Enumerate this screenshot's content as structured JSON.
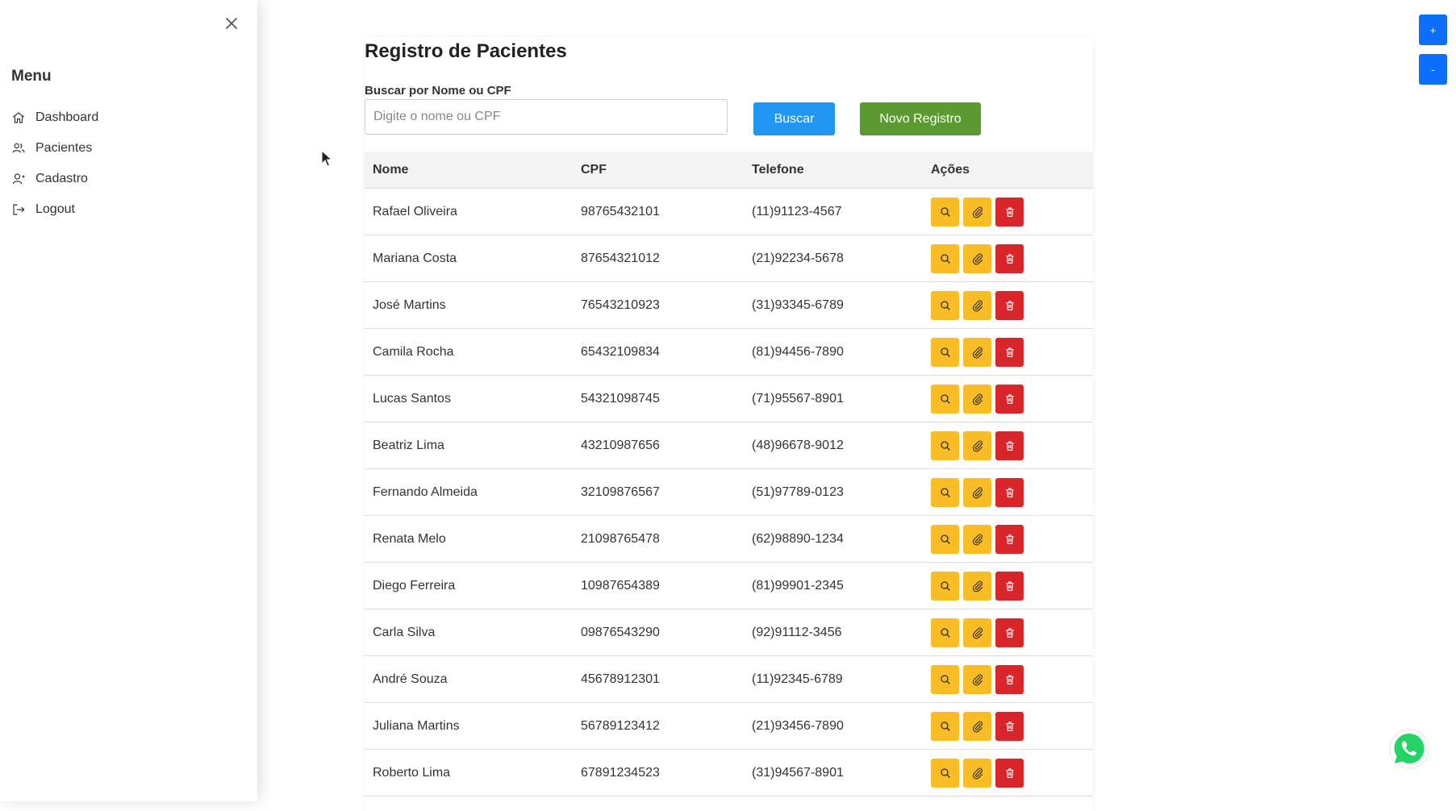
{
  "sidebar": {
    "title": "Menu",
    "items": [
      {
        "label": "Dashboard"
      },
      {
        "label": "Pacientes"
      },
      {
        "label": "Cadastro"
      },
      {
        "label": "Logout"
      }
    ]
  },
  "page": {
    "title": "Registro de Pacientes",
    "search_label": "Buscar por Nome ou CPF",
    "search_placeholder": "Digite o nome ou CPF",
    "search_button": "Buscar",
    "new_button": "Novo Registro"
  },
  "table": {
    "headers": [
      "Nome",
      "CPF",
      "Telefone",
      "Ações"
    ],
    "rows": [
      {
        "nome": "Rafael Oliveira",
        "cpf": "98765432101",
        "telefone": "(11)91123-4567"
      },
      {
        "nome": "Mariana Costa",
        "cpf": "87654321012",
        "telefone": "(21)92234-5678"
      },
      {
        "nome": "José Martins",
        "cpf": "76543210923",
        "telefone": "(31)93345-6789"
      },
      {
        "nome": "Camila Rocha",
        "cpf": "65432109834",
        "telefone": "(81)94456-7890"
      },
      {
        "nome": "Lucas Santos",
        "cpf": "54321098745",
        "telefone": "(71)95567-8901"
      },
      {
        "nome": "Beatriz Lima",
        "cpf": "43210987656",
        "telefone": "(48)96678-9012"
      },
      {
        "nome": "Fernando Almeida",
        "cpf": "32109876567",
        "telefone": "(51)97789-0123"
      },
      {
        "nome": "Renata Melo",
        "cpf": "21098765478",
        "telefone": "(62)98890-1234"
      },
      {
        "nome": "Diego Ferreira",
        "cpf": "10987654389",
        "telefone": "(81)99901-2345"
      },
      {
        "nome": "Carla Silva",
        "cpf": "09876543290",
        "telefone": "(92)91112-3456"
      },
      {
        "nome": "André Souza",
        "cpf": "45678912301",
        "telefone": "(11)92345-6789"
      },
      {
        "nome": "Juliana Martins",
        "cpf": "56789123412",
        "telefone": "(21)93456-7890"
      },
      {
        "nome": "Roberto Lima",
        "cpf": "67891234523",
        "telefone": "(31)94567-8901"
      }
    ]
  },
  "zoom": {
    "plus": "+",
    "minus": "-"
  },
  "colors": {
    "search_button": "#2196f3",
    "new_button": "#5a9a30",
    "action_yellow": "#fbbd25",
    "action_red": "#d9262a",
    "zoom_blue": "#0d6efd",
    "whatsapp_green": "#25d366"
  },
  "icons": {
    "close": "close-icon",
    "dashboard": "home-icon",
    "pacientes": "users-icon",
    "cadastro": "user-icon",
    "logout": "logout-icon",
    "view": "search-icon",
    "attach": "paperclip-icon",
    "delete": "trash-icon",
    "chat": "whatsapp-icon"
  }
}
